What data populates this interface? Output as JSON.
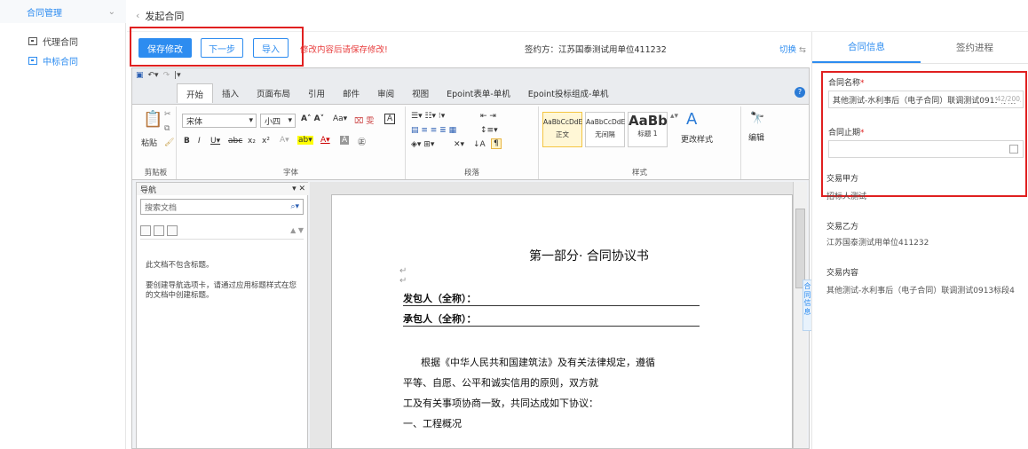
{
  "sidebar": {
    "section_label": "合同管理",
    "items": [
      {
        "label": "代理合同",
        "icon": "contract-icon"
      },
      {
        "label": "中标合同",
        "icon": "contract-icon"
      }
    ]
  },
  "breadcrumb": {
    "back": "‹",
    "title": "发起合同"
  },
  "toolbar": {
    "save_label": "保存修改",
    "next_label": "下一步",
    "import_label": "导入",
    "warning": "修改内容后请保存修改!",
    "signer": "签约方：江苏国泰测试用单位411232",
    "switch_label": "切换"
  },
  "word": {
    "ribbon_tabs": [
      "开始",
      "插入",
      "页面布局",
      "引用",
      "邮件",
      "审阅",
      "视图",
      "Epoint表单-单机",
      "Epoint投标组成-单机"
    ],
    "clipboard": {
      "paste": "粘贴",
      "label": "剪贴板"
    },
    "font": {
      "name": "宋体",
      "size": "小四",
      "label": "字体"
    },
    "paragraph": {
      "label": "段落"
    },
    "styles": {
      "items": [
        {
          "preview": "AaBbCcDdE",
          "name": "正文"
        },
        {
          "preview": "AaBbCcDdE",
          "name": "无间隔"
        },
        {
          "preview": "AaBb",
          "name": "标题 1"
        }
      ],
      "change": "更改样式",
      "label": "样式"
    },
    "editing": {
      "label": "编辑"
    },
    "nav": {
      "title": "导航",
      "search_placeholder": "搜索文档",
      "msg1": "此文档不包含标题。",
      "msg2": "要创建导航选项卡，请通过应用标题样式在您的文档中创建标题。"
    },
    "document": {
      "heading": "第一部分· 合同协议书",
      "employer": "发包人（全称）：",
      "contractor": "承包人（全称）：",
      "p1": "根据《中华人民共和国建筑法》及有关法律规定，遵循",
      "p2": "平等、自愿、公平和诚实信用的原则，双方就",
      "p3": "工及有关事项协商一致，共同达成如下协议：",
      "p4": "一、工程概况"
    }
  },
  "side_tab": "合同信息",
  "right_panel": {
    "tabs": [
      "合同信息",
      "签约进程"
    ],
    "name_label": "合同名称",
    "name_value": "其他测试-水利事后（电子合同）联调测试0913标段4",
    "name_count": "42/200",
    "deadline_label": "合同止期",
    "deadline_value": "",
    "party_a_label": "交易甲方",
    "party_a_value": "招标人测试",
    "party_b_label": "交易乙方",
    "party_b_value": "江苏国泰测试用单位411232",
    "content_label": "交易内容",
    "content_value": "其他测试-水利事后（电子合同）联调测试0913标段4"
  },
  "colors": {
    "accent": "#2d8cf0",
    "warning": "#e83d3d",
    "highlight_border": "#e02020"
  }
}
